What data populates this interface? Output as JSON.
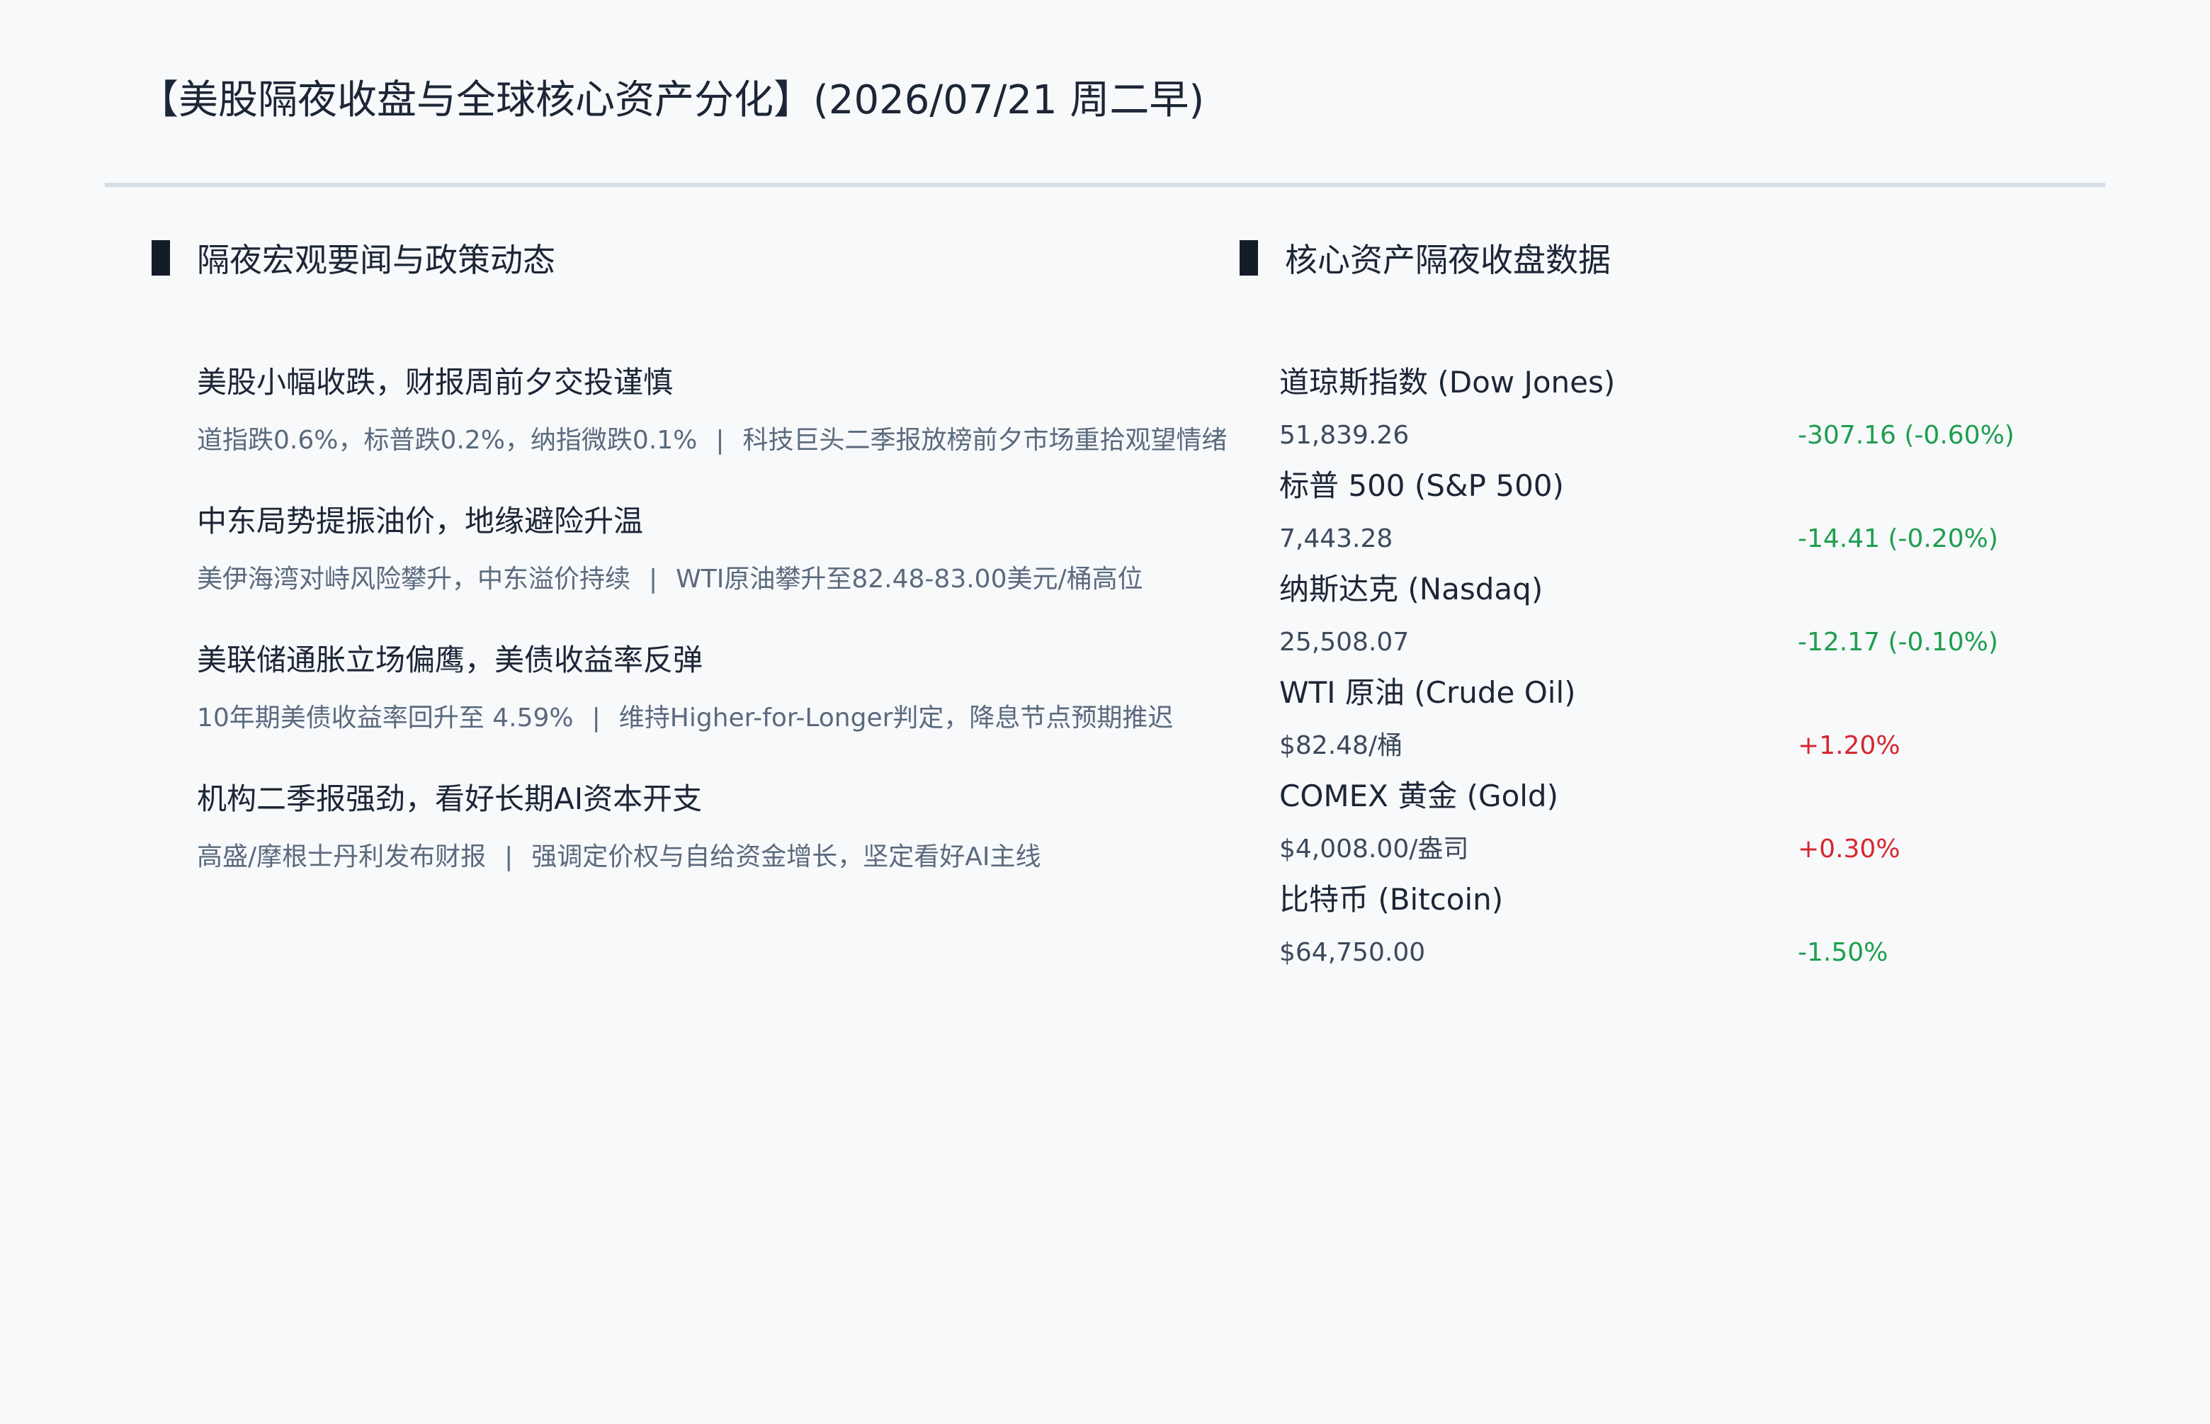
{
  "title": "【美股隔夜收盘与全球核心资产分化】(2026/07/21 周二早)",
  "sections": {
    "news_heading": "隔夜宏观要闻与政策动态",
    "assets_heading": "核心资产隔夜收盘数据"
  },
  "news": [
    {
      "headline": "美股小幅收跌，财报周前夕交投谨慎",
      "detail_left": "道指跌0.6%，标普跌0.2%，纳指微跌0.1%",
      "separator": "|",
      "detail_right": "科技巨头二季报放榜前夕市场重拾观望情绪"
    },
    {
      "headline": "中东局势提振油价，地缘避险升温",
      "detail_left": "美伊海湾对峙风险攀升，中东溢价持续",
      "separator": "|",
      "detail_right": "WTI原油攀升至82.48-83.00美元/桶高位"
    },
    {
      "headline": "美联储通胀立场偏鹰，美债收益率反弹",
      "detail_left": "10年期美债收益率回升至 4.59%",
      "separator": "|",
      "detail_right": "维持Higher-for-Longer判定，降息节点预期推迟"
    },
    {
      "headline": "机构二季报强劲，看好长期AI资本开支",
      "detail_left": "高盛/摩根士丹利发布财报",
      "separator": "|",
      "detail_right": "强调定价权与自给资金增长，坚定看好AI主线"
    }
  ],
  "assets": [
    {
      "name": "道琼斯指数 (Dow Jones)",
      "price": "51,839.26",
      "change": "-307.16 (-0.60%)",
      "direction": "down"
    },
    {
      "name": "标普 500 (S&P 500)",
      "price": "7,443.28",
      "change": "-14.41 (-0.20%)",
      "direction": "down"
    },
    {
      "name": "纳斯达克 (Nasdaq)",
      "price": "25,508.07",
      "change": "-12.17 (-0.10%)",
      "direction": "down"
    },
    {
      "name": "WTI 原油 (Crude Oil)",
      "price": "$82.48/桶",
      "change": "+1.20%",
      "direction": "up"
    },
    {
      "name": "COMEX 黄金 (Gold)",
      "price": "$4,008.00/盎司",
      "change": "+0.30%",
      "direction": "up"
    },
    {
      "name": "比特币 (Bitcoin)",
      "price": "$64,750.00",
      "change": "-1.50%",
      "direction": "down"
    }
  ],
  "colors": {
    "up": "#d7262e",
    "down": "#1e9e4d",
    "accent_bar": "#141c2a",
    "divider": "#d4dde6"
  }
}
